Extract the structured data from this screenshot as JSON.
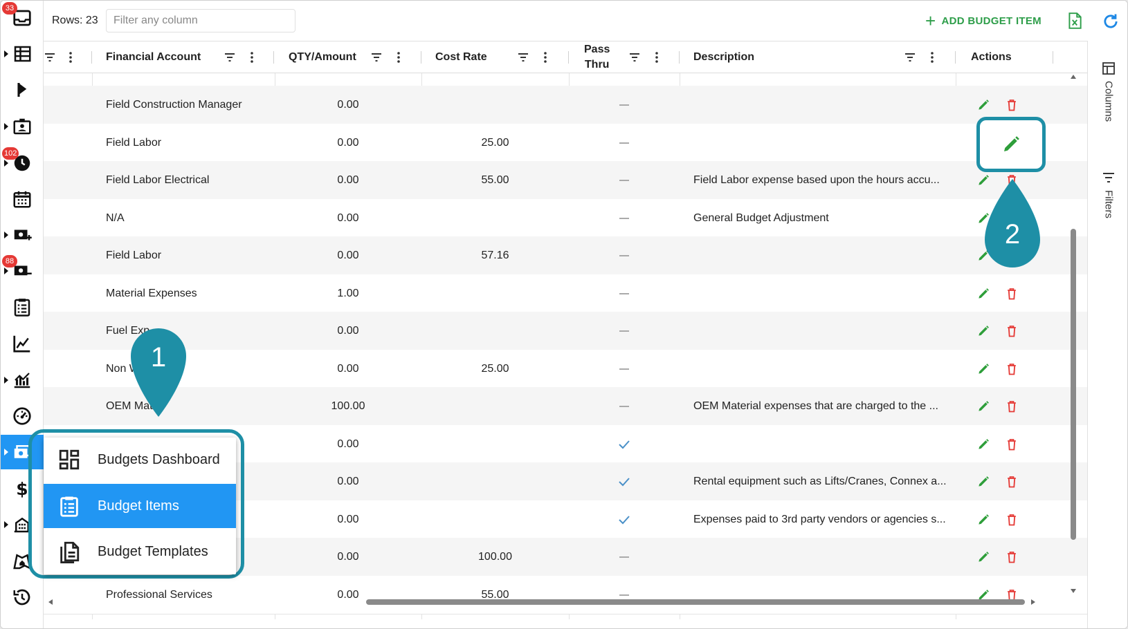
{
  "toolbar": {
    "rows_label": "Rows: 23",
    "filter_placeholder": "Filter any column",
    "add_label": "ADD BUDGET ITEM"
  },
  "rail": {
    "badges": {
      "inbox": "33",
      "clock": "102",
      "money": "88"
    }
  },
  "columns": {
    "financial_account": "Financial Account",
    "qty_amount": "QTY/Amount",
    "cost_rate": "Cost Rate",
    "pass_thru_line1": "Pass",
    "pass_thru_line2": "Thru",
    "description": "Description",
    "actions": "Actions"
  },
  "rows": [
    {
      "account": "Field Construction Manager",
      "qty": "0.00",
      "rate": "",
      "pass": "dash",
      "desc": ""
    },
    {
      "account": "Field Labor",
      "qty": "0.00",
      "rate": "25.00",
      "pass": "dash",
      "desc": ""
    },
    {
      "account": "Field Labor Electrical",
      "qty": "0.00",
      "rate": "55.00",
      "pass": "dash",
      "desc": "Field Labor expense based upon the hours accu..."
    },
    {
      "account": "N/A",
      "qty": "0.00",
      "rate": "",
      "pass": "dash",
      "desc": "General Budget Adjustment"
    },
    {
      "account": "Field Labor",
      "qty": "0.00",
      "rate": "57.16",
      "pass": "dash",
      "desc": ""
    },
    {
      "account": "Material Expenses",
      "qty": "1.00",
      "rate": "",
      "pass": "dash",
      "desc": ""
    },
    {
      "account": "Fuel Exp",
      "qty": "0.00",
      "rate": "",
      "pass": "dash",
      "desc": ""
    },
    {
      "account": "Non W",
      "qty": "0.00",
      "rate": "25.00",
      "pass": "dash",
      "desc": ""
    },
    {
      "account": "OEM Mate",
      "qty": "100.00",
      "rate": "",
      "pass": "dash",
      "desc": "OEM Material expenses that are charged to the ..."
    },
    {
      "account": "",
      "qty": "0.00",
      "rate": "",
      "pass": "check",
      "desc": ""
    },
    {
      "account": "",
      "qty": "0.00",
      "rate": "",
      "pass": "check",
      "desc": "Rental equipment such as Lifts/Cranes, Connex a..."
    },
    {
      "account": "",
      "qty": "0.00",
      "rate": "",
      "pass": "check",
      "desc": "Expenses paid to 3rd party vendors or agencies s..."
    },
    {
      "account": "",
      "qty": "0.00",
      "rate": "100.00",
      "pass": "dash",
      "desc": ""
    },
    {
      "account": "Professional Services",
      "qty": "0.00",
      "rate": "55.00",
      "pass": "dash",
      "desc": ""
    }
  ],
  "side_panel": {
    "columns_label": "Columns",
    "filters_label": "Filters"
  },
  "popup": {
    "items": [
      {
        "label": "Budgets Dashboard"
      },
      {
        "label": "Budget Items"
      },
      {
        "label": "Budget Templates"
      }
    ]
  },
  "callouts": {
    "one": "1",
    "two": "2"
  },
  "colors": {
    "accent": "#2196f3",
    "add_green": "#2e9e4a",
    "delete_red": "#e53935",
    "callout_teal": "#1e8fa6"
  }
}
